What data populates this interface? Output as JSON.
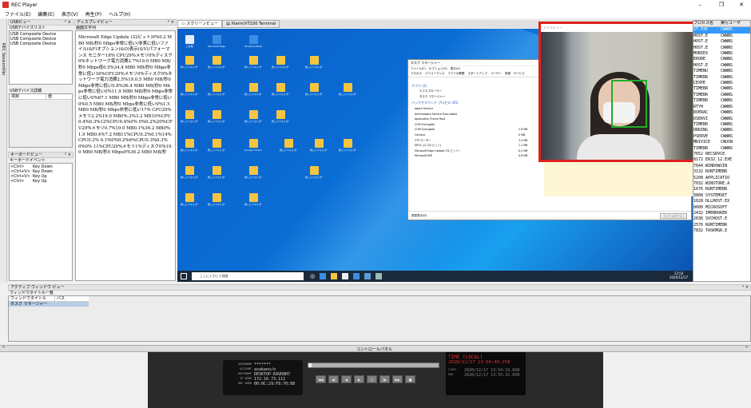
{
  "app": {
    "title": "REC Player"
  },
  "menu": [
    "ファイル(E)",
    "編集(E)",
    "表示(V)",
    "再生(P)",
    "ヘルプ(H)"
  ],
  "sidebar_tab": "REC SessionVIer",
  "usb_view": {
    "title": "USBビュー",
    "list_title": "USBデバイスリスト",
    "devices": [
      "USB Composite Device",
      "USB Composite Device",
      "USB Composite Device"
    ]
  },
  "usb_detail": {
    "title": "USBデバイス詳細",
    "col_item": "項目",
    "col_value": "値"
  },
  "keyboard_view": {
    "title": "キーボードビュー",
    "subtitle": "キーボードイベント",
    "events": [
      {
        "key": "<Ctrl>",
        "action": "Key Down"
      },
      {
        "key": "<Ctrl+V>",
        "action": "Key Down"
      },
      {
        "key": "<Ctrl+V>",
        "action": "Key Up"
      },
      {
        "key": "<Ctrl>",
        "action": "Key Up"
      }
    ]
  },
  "display_view": {
    "title": "ディスプレイビュー",
    "subtitle": "画面文字列",
    "text": "Microsoft Edge Update (32ビット)0%0.2 MB0 MB/秒0 Mbps非常に低い(非実に低いファイル(&F)オプション(&O)表示(&V)パフォーマンス モニター18% CPU29%メモリ0%ディスク0%ネットワーク電力消費2.7%19.0 MB0 MB/秒0 Mbps低0.5%34.4 MB0 MB/秒0 Mbps非常に低い16%CPU29%メモリ0%ディスク0%ネットワーク電力消費2.5%19.0.5 MB0 MB/秒0 Mbps非常に低い0.8%36.4 MB0 MB/秒0 Mbps非常に低い0%11.9 MB0 MB/秒0 Mbps非常に低い0%67.1 MB0 MB/秒0 Mbps非常に低い0%0.5 MB0 MB/秒0 Mbps非常に低い0%1.5 MB0 MB/秒0 Mbps非常に低い17% CPU29%メモリ2.2%19.0 MB0%.2%3.2 MB10%CPU0.4%0.3%12%CPU0.4%0% 0%0.2%20%CPU29%メモリ0.7%19.0 MB0.1%36.2 MB0%1.9 MB0.4%7.2 MB11%CPU0.2%0.1%14%CPU0.2% 0.1%0%0.2%6%CPU0.3%0.3%0%0% 11%CPU29%メモリ1%ディスク0%19.0 MB0 MB/秒0 Mbps0%36.2 MB0 MB/秒"
  },
  "screen_tabs": [
    "スクリーンビュー",
    "Xterm/VT100 Terminal"
  ],
  "desktop_icons": [
    "ごみ箱",
    "Microsoft Edge",
    "Windows Media",
    "新しいフォルダー",
    "新しいフォルダー",
    "新しいフォルダー",
    "新しいフォルダー",
    "新しいフォルダー",
    "新しいフォルダー",
    "新しいフォルダー",
    "新しいフォルダー",
    "新しいフォルダー",
    "新しいフォルダー",
    "新しいフォルダー",
    "新しいフォルダー",
    "新しいフォルダー",
    "新しいフォルダー",
    "新しいフォルダー",
    "新しいフォルダー",
    "新しいフォルダー",
    "Google Chrome",
    "新しいフォルダー",
    "新しいフォルダー",
    "新しいフォルダー",
    "新しいフォルダー",
    "新しいフォルダー",
    "新しいフォルダー",
    "新しいフォルダー",
    "新しいフォルダー",
    "新しいフォルダー",
    "新しいフォルダー"
  ],
  "taskbar": {
    "search_placeholder": "ここに入力して検索",
    "clock_time": "13:54",
    "clock_date": "2020/12/17"
  },
  "task_manager": {
    "title": "タスク マネージャー",
    "menu": [
      "ファイル(F)",
      "オプション(O)",
      "表示(V)"
    ],
    "tabs": [
      "プロセス",
      "パフォーマンス",
      "アプリの履歴",
      "スタートアップ",
      "ユーザー",
      "詳細",
      "サービス"
    ],
    "apps_header": "アプリ (2)",
    "apps": [
      "エクスプローラー",
      "タスク マネージャー"
    ],
    "bg_header": "バックグラウンド プロセス (45)",
    "bg": [
      {
        "name": "Agent Service",
        "mem": "",
        "disk": "",
        "net": "",
        "pw": "",
        "pw2": ""
      },
      {
        "name": "Antimalware Service Executable",
        "mem": "",
        "disk": "",
        "net": "",
        "pw": "",
        "pw2": ""
      },
      {
        "name": "Application Frame Host",
        "mem": "",
        "disk": "",
        "net": "",
        "pw": "",
        "pw2": ""
      },
      {
        "name": "COM Surrogate",
        "mem": "",
        "disk": "",
        "net": "",
        "pw": "",
        "pw2": ""
      },
      {
        "name": "COM Surrogate",
        "mem": "2.9 MB",
        "disk": "0 MB/秒",
        "net": "0 Mbps",
        "pw": "非常に低い",
        "pw2": "非常に低い"
      },
      {
        "name": "Cortana",
        "mem": "0 MB",
        "disk": "0 MB/秒",
        "net": "0 Mbps",
        "pw": "非常に低い",
        "pw2": "非常に低い"
      },
      {
        "name": "CTF ローダー",
        "mem": "3.2 MB",
        "disk": "0 MB/秒",
        "net": "0 Mbps",
        "pw": "非常に低い",
        "pw2": "非常に低い"
      },
      {
        "name": "ER32_12 (32 ビット)",
        "mem": "1.1 MB",
        "disk": "0 MB/秒",
        "net": "0 Mbps",
        "pw": "非常に低い",
        "pw2": "非常に低い"
      },
      {
        "name": "Microsoft Edge Update (32 ビット)",
        "mem": "0.2 MB",
        "disk": "0 MB/秒",
        "net": "0 Mbps",
        "pw": "非常に低い",
        "pw2": "非常に低い"
      },
      {
        "name": "Microsoft IME",
        "mem": "0.8 MB",
        "disk": "0 MB/秒",
        "net": "0 Mbps",
        "pw": "非常に低い",
        "pw2": "非常に低い"
      }
    ],
    "footer_left": "簡易表示(D)",
    "footer_button": "タスクの終了(E)"
  },
  "camera": {
    "title": "カメラビュー"
  },
  "process_panel": {
    "col_pid": "プロセス名",
    "col_user": "実行ユーザ",
    "rows": [
      {
        "pid": "ST.EXE",
        "user": "CWWNS",
        "hl": true
      },
      {
        "pid": "HOST.E",
        "user": "CWWNS",
        "hl": false
      },
      {
        "pid": "HOST.E",
        "user": "CWWNS",
        "hl": false
      },
      {
        "pid": "HOST.E",
        "user": "CWWNS",
        "hl": false
      },
      {
        "pid": "MONIEX",
        "user": "CWWNS",
        "hl": false
      },
      {
        "pid": "ERORE",
        "user": "CWWNS",
        "hl": false
      },
      {
        "pid": "HOST.E",
        "user": "CWWNS",
        "hl": false
      },
      {
        "pid": "TIMENU",
        "user": "CWWNS",
        "hl": false
      },
      {
        "pid": "TIMEBR",
        "user": "CWWNS",
        "hl": false
      },
      {
        "pid": "CEXPE",
        "user": "CWWNS",
        "hl": false
      },
      {
        "pid": "TIMEBR",
        "user": "CWWNS",
        "hl": false
      },
      {
        "pid": "TIMEBR",
        "user": "CWWNS",
        "hl": false
      },
      {
        "pid": "TIMEBR",
        "user": "CWWNS",
        "hl": false
      },
      {
        "pid": "RTYH",
        "user": "CWWNS",
        "hl": false
      },
      {
        "pid": "RVERAC",
        "user": "CWWNS",
        "hl": false
      },
      {
        "pid": "DSERVI",
        "user": "CWWNS",
        "hl": false
      },
      {
        "pid": "TIMEBR",
        "user": "CWWNS",
        "hl": false
      },
      {
        "pid": "ORDING",
        "user": "CWWNS",
        "hl": false
      },
      {
        "pid": "PSERVE",
        "user": "CWWNS",
        "hl": false
      },
      {
        "pid": "MRIVICE",
        "user": "CWUSN",
        "hl": false
      },
      {
        "pid": "TIMEBR",
        "user": "CWWNS",
        "hl": false
      },
      {
        "pid": "7652 RECSRVCE.",
        "user": "",
        "hl": false
      },
      {
        "pid": "8172 ER32_12.EXE",
        "user": "",
        "hl": false
      },
      {
        "pid": "7644 WINDOWSIN",
        "user": "",
        "hl": false
      },
      {
        "pid": "3132 RUNTIMEBR",
        "user": "",
        "hl": false
      },
      {
        "pid": "5208 APPLICATIO",
        "user": "",
        "hl": false
      },
      {
        "pid": "7032 WINSTORE.A",
        "user": "",
        "hl": false
      },
      {
        "pid": "1676 RUNTIMEBR",
        "user": "",
        "hl": false
      },
      {
        "pid": "3808 SYSTEMSET",
        "user": "",
        "hl": false
      },
      {
        "pid": "1628 DLLHOST.EX",
        "user": "",
        "hl": false
      },
      {
        "pid": "0600 MICROSOFT",
        "user": "",
        "hl": false
      },
      {
        "pid": "2432 IMEBROKER",
        "user": "",
        "hl": false
      },
      {
        "pid": "2636 SVCHOST.E",
        "user": "",
        "hl": false
      },
      {
        "pid": "2576 RUNTIMEBR",
        "user": "",
        "hl": false
      },
      {
        "pid": "7832 TASKMGR.E",
        "user": "",
        "hl": false
      }
    ]
  },
  "active_window": {
    "title": "アクティブ ウィンドウ ビュー",
    "subtitle": "ウィンドウタイトル一覧",
    "col_title": "ウィンドウタイトル",
    "col_path": "パス",
    "rows": [
      {
        "title": "タスク マネージャー",
        "path": ""
      }
    ]
  },
  "control_panel": {
    "title": "コントロールパネル",
    "username_label": "USERNAME",
    "username": "*******",
    "account_label": "ACCOUNT",
    "account": "asakano/o",
    "hostname_label": "HOSTNAME",
    "hostname": "DESKTOP-EAVD8H7",
    "ip_label": "IP ADDR",
    "ip": "172.16.73.111",
    "mac_label": "MAC ADDR",
    "mac": "00:0C:29:F8:70:08",
    "time_label": "TIME (LOCAL)",
    "time": "2020/12/17 13:54:40.258",
    "start_label": "START",
    "start": "2020/12/17 13:54:19.848",
    "end_label": "END",
    "end": "2020/12/17 13:55:15.658",
    "buttons": [
      "◀◀",
      "◀|",
      "◀",
      "▶",
      "||",
      "|▶",
      "▶▶",
      "■"
    ]
  }
}
